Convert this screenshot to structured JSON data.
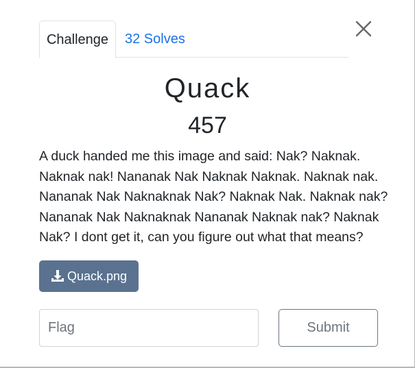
{
  "tabs": [
    {
      "label": "Challenge"
    },
    {
      "label": "32 Solves"
    }
  ],
  "challenge": {
    "name": "Quack",
    "points": "457",
    "description_lines": [
      "A duck handed me this image and said: Nak? Naknak.",
      "Naknak nak! Nananak Nak Naknak Naknak. Naknak nak.",
      "Nananak Nak Naknaknak Nak? Naknak Nak. Naknak nak?",
      "Nananak Nak Naknaknak Nananak Naknak nak? Naknak",
      "Nak? I dont get it, can you figure out what that means?"
    ]
  },
  "file": {
    "label": "Quack.png",
    "icon": "download-icon"
  },
  "flag": {
    "placeholder": "Flag",
    "value": ""
  },
  "submit": {
    "label": "Submit"
  },
  "close": {
    "icon": "close-icon"
  },
  "colors": {
    "accent_link": "#1a73e8",
    "file_button_bg": "#5a7290",
    "text": "#212529"
  }
}
